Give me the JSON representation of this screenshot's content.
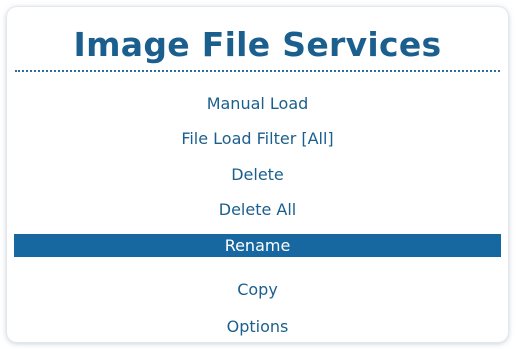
{
  "menu": {
    "title": "Image File Services",
    "items": [
      {
        "label": "Manual Load"
      },
      {
        "label": "File Load Filter [All]"
      },
      {
        "label": "Delete"
      },
      {
        "label": "Delete All"
      },
      {
        "label": "Rename"
      },
      {
        "label": "Copy"
      },
      {
        "label": "Options"
      }
    ],
    "selected_item": "Rename"
  },
  "colors": {
    "title_text": "#1b5f8e",
    "item_text": "#1b5f8e",
    "selection_background": "#1768a0",
    "selection_text": "#ffffff",
    "panel_background": "#ffffff"
  }
}
